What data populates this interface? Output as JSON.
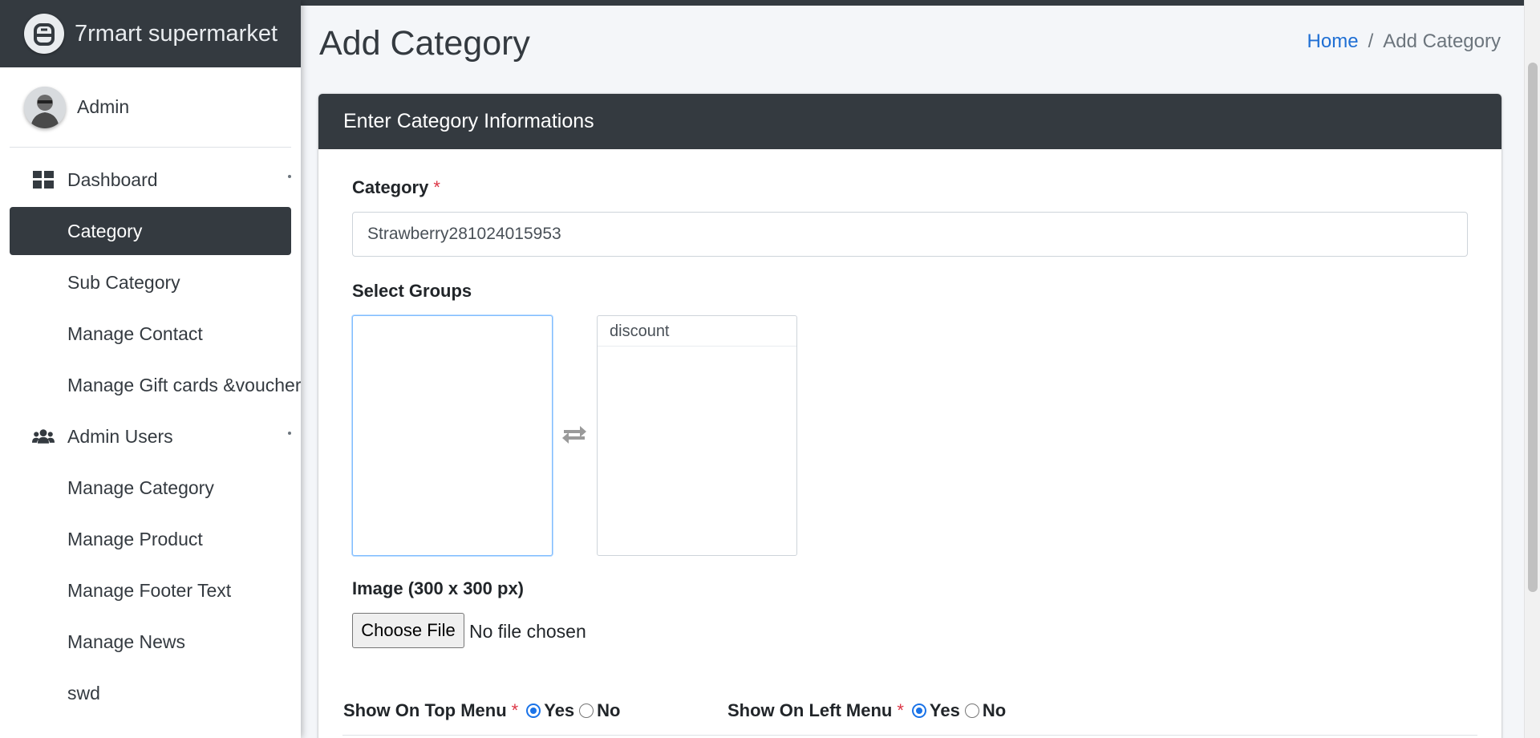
{
  "brand": {
    "name": "7rmart supermarket",
    "logo_icon": "app-logo-icon"
  },
  "user": {
    "name": "Admin"
  },
  "sidebar": {
    "items": [
      {
        "label": "Dashboard",
        "icon": "dashboard-grid-icon"
      },
      {
        "label": "Category"
      },
      {
        "label": "Sub Category"
      },
      {
        "label": "Manage Contact"
      },
      {
        "label": "Manage Gift cards &voucher"
      },
      {
        "label": "Admin Users",
        "icon": "users-icon"
      },
      {
        "label": "Manage Category"
      },
      {
        "label": "Manage Product"
      },
      {
        "label": "Manage Footer Text"
      },
      {
        "label": "Manage News"
      },
      {
        "label": "swd"
      }
    ],
    "active": "Category"
  },
  "page": {
    "title": "Add Category"
  },
  "breadcrumb": {
    "home": "Home",
    "separator": "/",
    "current": "Add Category"
  },
  "form": {
    "header": "Enter Category Informations",
    "category_label": "Category",
    "required_mark": "*",
    "category_value": "Strawberry281024015953",
    "groups_label": "Select Groups",
    "available_groups": [],
    "selected_groups": [
      "discount"
    ],
    "image_label": "Image (300 x 300 px)",
    "file_button": "Choose File",
    "file_status": "No file chosen",
    "top_menu_label": "Show On Top Menu",
    "left_menu_label": "Show On Left Menu",
    "yes": "Yes",
    "no": "No",
    "top_menu_value": "Yes",
    "left_menu_value": "Yes"
  },
  "colors": {
    "dark": "#343a40",
    "link": "#1f6fd4",
    "required": "#dc3545",
    "radio": "#1a73e8"
  }
}
